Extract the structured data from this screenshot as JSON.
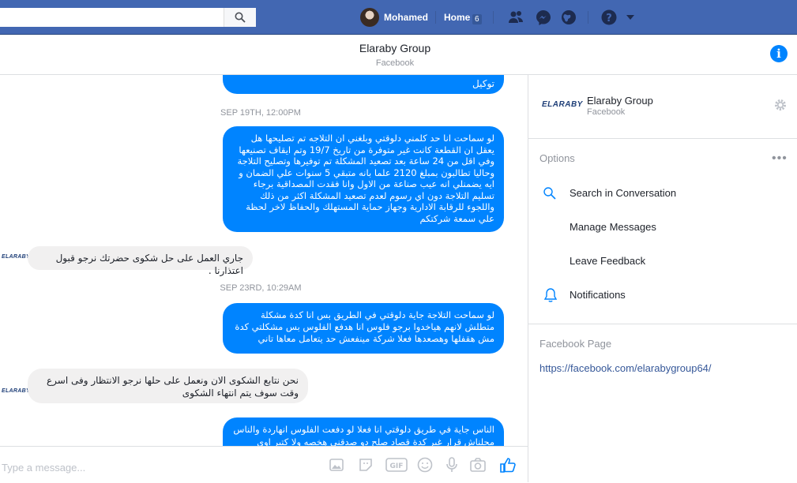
{
  "topbar": {
    "user_name": "Mohamed",
    "home_label": "Home",
    "home_badge": "6"
  },
  "conversation": {
    "title": "Elaraby Group",
    "subtitle": "Facebook"
  },
  "messages": [
    {
      "from": "me",
      "text": "توكيل"
    },
    {
      "type": "timestamp",
      "text": "SEP 19TH, 12:00PM"
    },
    {
      "from": "me",
      "text": "لو سماحت انا حد كلمني دلوقتي وبلغني ان التلاجه تم تصليحها هل يعقل ان القطعة كانت غير متوفرة من تاريخ 19/7 وتم ايقاف تصنيعها وفي اقل من 24 ساعة بعد تصعيد المشكلة تم توفيرها وتصليح التلاجة وحاليا تطالبون بمبلغ 2120 علما بانه متبقي 5 سنوات علي الضمان و ايه يضمنلي انه عيب صناعة من الاول وانا فقدت المصداقية برجاء تسليم التلاجة دون اي رسوم لعدم تصعيد المشكلة اكثر من ذلك واللجوء للرقابة الادارية وجهاز حماية المستهلك والحفاظ لاخر لحظة علي سمعة شركتكم"
    },
    {
      "from": "them",
      "text": "جاري العمل على حل شكوى حضرتك نرجو قبول اعتذارنا ."
    },
    {
      "type": "timestamp",
      "text": "SEP 23RD, 10:29AM"
    },
    {
      "from": "me",
      "text": "لو سماحت التلاجة جاية دلوقتي في الطريق بس انا كدة مشكلة متطلش لانهم هياخدوا برجو فلوس انا هدفع الفلوس بس مشكلتي كدة مش هقفلها وهصعدها فعلا شركة مينفعش حد يتعامل معاها تاني"
    },
    {
      "from": "them",
      "text": "نحن نتابع الشكوى الان ونعمل على حلها نرجو الانتظار وفى اسرع وقت سوف يتم انتهاء الشكوى"
    },
    {
      "from": "me",
      "text": "الناس جاية في طريق دلوقتي انا فعلا لو دفعت الفلوس انهاردة والناس مجلناش قرار غير كدة قصاد صلح دو صدقني هخصه ولا كتير اوي"
    }
  ],
  "sender_logo": "ELARABY",
  "composer": {
    "placeholder": "Type a message..."
  },
  "sidebar": {
    "org_name": "Elaraby Group",
    "org_sub": "Facebook",
    "logo_text": "ELARABY",
    "options_title": "Options",
    "options": [
      {
        "label": "Search in Conversation",
        "icon": "search-icon"
      },
      {
        "label": "Manage Messages",
        "icon": ""
      },
      {
        "label": "Leave Feedback",
        "icon": ""
      },
      {
        "label": "Notifications",
        "icon": "bell-icon"
      }
    ],
    "page_title": "Facebook Page",
    "page_link": "https://facebook.com/elarabygroup64/"
  },
  "colors": {
    "topbar": "#4267b2",
    "accent": "#0084ff",
    "bubble_them": "#f1f0f0"
  }
}
